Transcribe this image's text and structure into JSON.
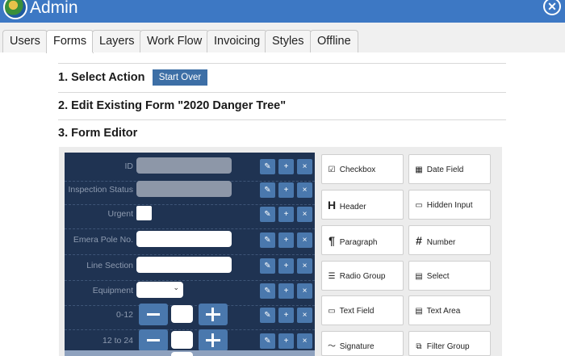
{
  "app": {
    "title": "Admin",
    "close_icon": "close-circle-icon"
  },
  "tabs": [
    "Users",
    "Forms",
    "Layers",
    "Work Flow",
    "Invoicing",
    "Styles",
    "Offline"
  ],
  "active_tab": "Forms",
  "steps": {
    "step1": "1. Select Action",
    "start_over": "Start Over",
    "step2": "2. Edit Existing Form \"2020 Danger Tree\"",
    "step3": "3. Form Editor"
  },
  "form_fields": [
    {
      "label": "ID",
      "control": "disabled-text"
    },
    {
      "label": "Inspection Status",
      "control": "disabled-text"
    },
    {
      "label": "Urgent",
      "control": "checkbox"
    },
    {
      "label": "Emera Pole No.",
      "control": "text"
    },
    {
      "label": "Line Section",
      "control": "text"
    },
    {
      "label": "Equipment",
      "control": "select"
    },
    {
      "label": "0-12",
      "control": "number-stepper"
    },
    {
      "label": "12 to 24",
      "control": "number-stepper"
    }
  ],
  "row_actions": {
    "edit_icon": "pencil-icon",
    "add_icon": "plus-icon",
    "delete_icon": "x-icon",
    "edit": "✎",
    "add": "+",
    "delete": "×"
  },
  "widgets": [
    {
      "label": "Checkbox",
      "icon": "checkbox-icon",
      "glyph": "☑"
    },
    {
      "label": "Date Field",
      "icon": "calendar-icon",
      "glyph": "▦"
    },
    {
      "label": "Header",
      "icon": "header-icon",
      "glyph": "H"
    },
    {
      "label": "Hidden Input",
      "icon": "hidden-input-icon",
      "glyph": "▭"
    },
    {
      "label": "Paragraph",
      "icon": "paragraph-icon",
      "glyph": "¶"
    },
    {
      "label": "Number",
      "icon": "number-icon",
      "glyph": "#"
    },
    {
      "label": "Radio Group",
      "icon": "radio-list-icon",
      "glyph": "☰"
    },
    {
      "label": "Select",
      "icon": "select-icon",
      "glyph": "▤"
    },
    {
      "label": "Text Field",
      "icon": "text-field-icon",
      "glyph": "▭"
    },
    {
      "label": "Text Area",
      "icon": "text-area-icon",
      "glyph": "▤"
    },
    {
      "label": "Signature",
      "icon": "signature-icon",
      "glyph": "〜"
    },
    {
      "label": "Filter Group",
      "icon": "filter-group-icon",
      "glyph": "⧉"
    }
  ],
  "colors": {
    "header": "#3d78c4",
    "panel": "#1f3352",
    "button": "#4a78ad"
  }
}
